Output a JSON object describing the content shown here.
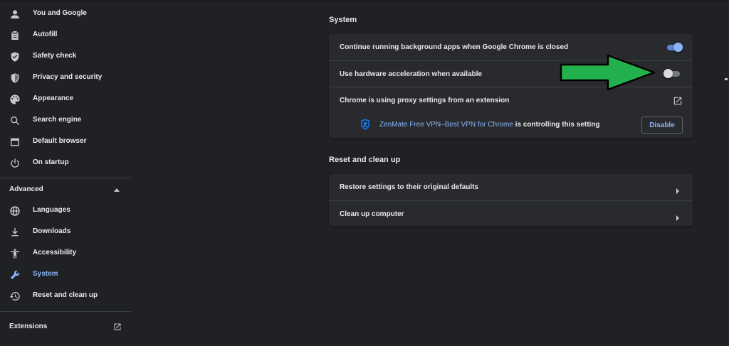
{
  "sidebar": {
    "items": [
      {
        "label": "You and Google",
        "icon": "person-icon"
      },
      {
        "label": "Autofill",
        "icon": "clipboard-icon"
      },
      {
        "label": "Safety check",
        "icon": "shield-check-icon"
      },
      {
        "label": "Privacy and security",
        "icon": "shield-icon"
      },
      {
        "label": "Appearance",
        "icon": "palette-icon"
      },
      {
        "label": "Search engine",
        "icon": "search-icon"
      },
      {
        "label": "Default browser",
        "icon": "browser-window-icon"
      },
      {
        "label": "On startup",
        "icon": "power-icon"
      }
    ],
    "advanced_label": "Advanced",
    "advanced_items": [
      {
        "label": "Languages",
        "icon": "globe-icon"
      },
      {
        "label": "Downloads",
        "icon": "download-icon"
      },
      {
        "label": "Accessibility",
        "icon": "accessibility-icon"
      },
      {
        "label": "System",
        "icon": "wrench-icon",
        "active": true
      },
      {
        "label": "Reset and clean up",
        "icon": "history-icon"
      }
    ],
    "extensions_label": "Extensions"
  },
  "system": {
    "title": "System",
    "background_apps_label": "Continue running background apps when Google Chrome is closed",
    "background_apps_enabled": true,
    "hardware_accel_label": "Use hardware acceleration when available",
    "hardware_accel_enabled": false,
    "proxy_label": "Chrome is using proxy settings from an extension",
    "extension_name": "ZenMate Free VPN–Best VPN for Chrome",
    "extension_suffix": " is controlling this setting",
    "disable_label": "Disable"
  },
  "reset": {
    "title": "Reset and clean up",
    "restore_label": "Restore settings to their original defaults",
    "cleanup_label": "Clean up computer"
  },
  "colors": {
    "background": "#202124",
    "card": "#292a2d",
    "accent": "#8ab4f8",
    "annotation_arrow": "#22b14c"
  }
}
